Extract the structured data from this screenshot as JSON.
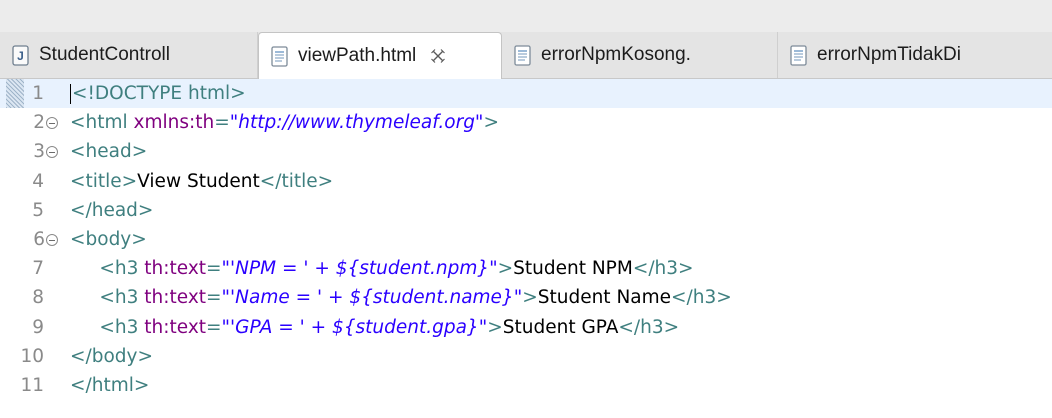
{
  "tabs": [
    {
      "label": "StudentControll",
      "icon": "java-file-icon",
      "active": false
    },
    {
      "label": "viewPath.html",
      "icon": "html-file-icon",
      "active": true
    },
    {
      "label": "errorNpmKosong.",
      "icon": "html-file-icon",
      "active": false
    },
    {
      "label": "errorNpmTidakDi",
      "icon": "html-file-icon",
      "active": false
    }
  ],
  "editor": {
    "lines": [
      {
        "num": "1",
        "fold": false,
        "indent": "",
        "tokens": [
          [
            "doc",
            "<!DOCTYPE html>"
          ]
        ]
      },
      {
        "num": "2",
        "fold": true,
        "indent": "",
        "tokens": [
          [
            "tag",
            "<html "
          ],
          [
            "attr",
            "xmlns:th"
          ],
          [
            "tag",
            "="
          ],
          [
            "val",
            "\"http://www.thymeleaf.org\""
          ],
          [
            "tag",
            ">"
          ]
        ]
      },
      {
        "num": "3",
        "fold": true,
        "indent": "",
        "tokens": [
          [
            "tag",
            "<head>"
          ]
        ]
      },
      {
        "num": "4",
        "fold": false,
        "indent": "",
        "tokens": [
          [
            "tag",
            "<title>"
          ],
          [
            "text",
            "View Student"
          ],
          [
            "tag",
            "</title>"
          ]
        ]
      },
      {
        "num": "5",
        "fold": false,
        "indent": "",
        "tokens": [
          [
            "tag",
            "</head>"
          ]
        ]
      },
      {
        "num": "6",
        "fold": true,
        "indent": "",
        "tokens": [
          [
            "tag",
            "<body>"
          ]
        ]
      },
      {
        "num": "7",
        "fold": false,
        "indent": "     ",
        "tokens": [
          [
            "tag",
            "<h3 "
          ],
          [
            "attr",
            "th:text"
          ],
          [
            "tag",
            "="
          ],
          [
            "val",
            "\"'NPM = ' + ${student.npm}\""
          ],
          [
            "tag",
            ">"
          ],
          [
            "text",
            "Student NPM"
          ],
          [
            "tag",
            "</h3>"
          ]
        ]
      },
      {
        "num": "8",
        "fold": false,
        "indent": "     ",
        "tokens": [
          [
            "tag",
            "<h3 "
          ],
          [
            "attr",
            "th:text"
          ],
          [
            "tag",
            "="
          ],
          [
            "val",
            "\"'Name = ' + ${student.name}\""
          ],
          [
            "tag",
            ">"
          ],
          [
            "text",
            "Student Name"
          ],
          [
            "tag",
            "</h3>"
          ]
        ]
      },
      {
        "num": "9",
        "fold": false,
        "indent": "     ",
        "tokens": [
          [
            "tag",
            "<h3 "
          ],
          [
            "attr",
            "th:text"
          ],
          [
            "tag",
            "="
          ],
          [
            "val",
            "\"'GPA = ' + ${student.gpa}\""
          ],
          [
            "tag",
            ">"
          ],
          [
            "text",
            "Student GPA"
          ],
          [
            "tag",
            "</h3>"
          ]
        ]
      },
      {
        "num": "10",
        "fold": false,
        "indent": "",
        "tokens": [
          [
            "tag",
            "</body>"
          ]
        ]
      },
      {
        "num": "11",
        "fold": false,
        "indent": "",
        "tokens": [
          [
            "tag",
            "</html>"
          ]
        ]
      }
    ]
  },
  "colors": {
    "tag": "#3f7f7f",
    "attr": "#7f007f",
    "value": "#2a00ff",
    "current_line": "#e8f2fe"
  }
}
